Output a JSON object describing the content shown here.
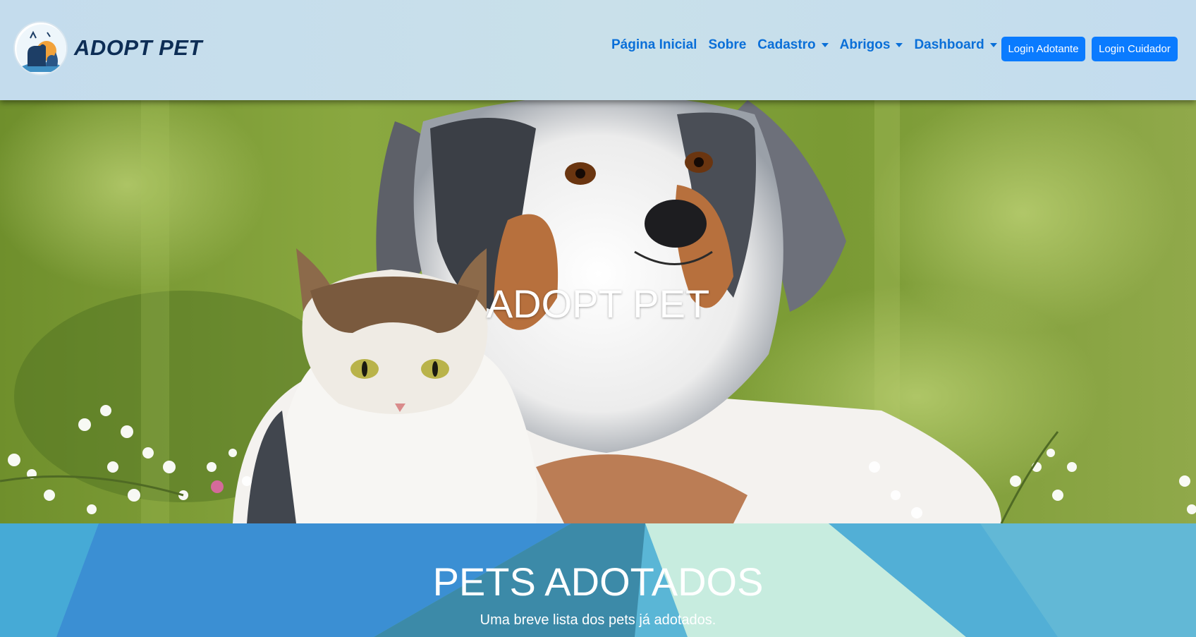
{
  "brand": {
    "name": "ADOPT PET",
    "logo_icon": "dog-and-cat-logo-icon"
  },
  "nav": {
    "home": "Página Inicial",
    "about": "Sobre",
    "register": "Cadastro",
    "shelters": "Abrigos",
    "dashboard": "Dashboard"
  },
  "buttons": {
    "login_adopter": "Login Adotante",
    "login_caretaker": "Login Cuidador"
  },
  "hero": {
    "title": "ADOPT PET",
    "image": "dog-and-cat-photo"
  },
  "adopted": {
    "title": "PETS ADOTADOS",
    "subtitle": "Uma breve lista dos pets já adotados."
  },
  "colors": {
    "header_bg": "#c6deec",
    "nav_link": "#0a6fd8",
    "button_bg": "#0a7bff",
    "brand_text": "#0d2d55",
    "section_bg": "#5ab6d6"
  }
}
